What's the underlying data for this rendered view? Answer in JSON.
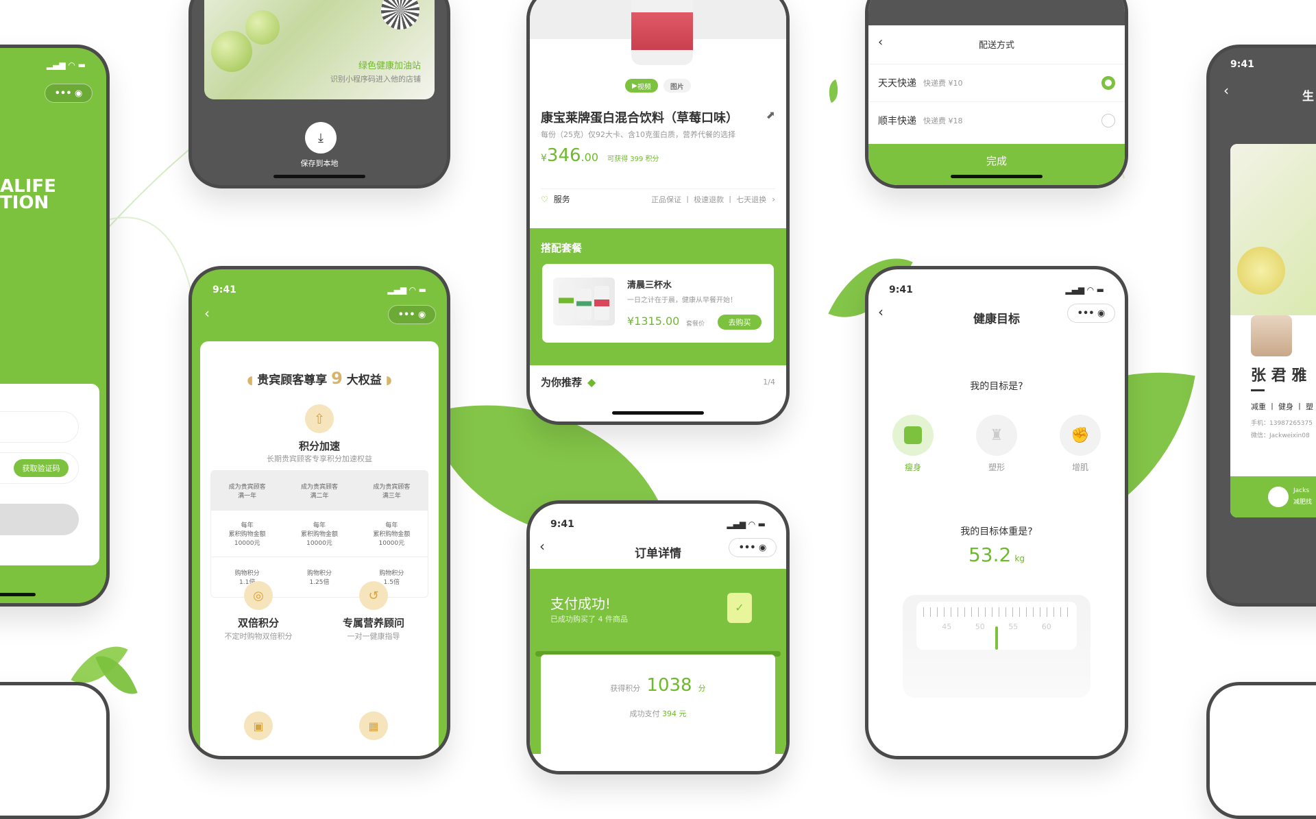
{
  "colors": {
    "accent": "#7cc23e",
    "dark_frame": "#4a4a4a"
  },
  "phone_a": {
    "brand_line1": "ALIFE",
    "brand_line2": "TION",
    "verify_btn": "获取验证码"
  },
  "phone_b": {
    "shop_name": "绿色健康加油站",
    "shop_hint": "识别小程序码进入他的店铺",
    "save_label": "保存到本地",
    "icon": "download-icon"
  },
  "phone_c": {
    "status_time": "9:41",
    "header_pre": "贵宾顾客尊享",
    "header_num": "9",
    "header_post": "大权益",
    "benefit1_title": "积分加速",
    "benefit1_desc": "长期贵宾顾客专享积分加速权益",
    "table": {
      "headers": [
        [
          "成为贵宾顾客",
          "满一年"
        ],
        [
          "成为贵宾顾客",
          "满二年"
        ],
        [
          "成为贵宾顾客",
          "满三年"
        ]
      ],
      "row1": [
        [
          "每年",
          "累积购物金额",
          "10000元"
        ],
        [
          "每年",
          "累积购物金额",
          "10000元"
        ],
        [
          "每年",
          "累积购物金额",
          "10000元"
        ]
      ],
      "row2": [
        [
          "购物积分",
          "1.1倍"
        ],
        [
          "购物积分",
          "1.25倍"
        ],
        [
          "购物积分",
          "1.5倍"
        ]
      ]
    },
    "benefit2_title": "双倍积分",
    "benefit2_desc": "不定时购物双倍积分",
    "benefit3_title": "专属营养顾问",
    "benefit3_desc": "一对一健康指导"
  },
  "phone_d": {
    "tab_video": "视频",
    "tab_image": "图片",
    "product_title": "康宝莱牌蛋白混合饮料（草莓口味）",
    "product_desc": "每份（25克）仅92大卡、含10克蛋白质，营养代餐的选择",
    "price_symbol": "¥",
    "price_int": "346",
    "price_dec": ".00",
    "points_note": "可获得 399 积分",
    "service_label": "服务",
    "service_items": "正品保证 丨 极速退款 丨 七天退换",
    "bundle_title": "搭配套餐",
    "bundle_name": "清晨三杯水",
    "bundle_desc": "一日之计在于晨，健康从早餐开始！",
    "bundle_price": "¥1315.00",
    "bundle_price_note": "套餐价",
    "bundle_btn": "去购买",
    "recommend_label": "为你推荐",
    "recommend_page": "1/4"
  },
  "phone_e": {
    "status_time": "9:41",
    "title": "订单详情",
    "success_title": "支付成功!",
    "success_desc": "已成功购买了 4 件商品",
    "points_label": "获得积分",
    "points_value": "1038",
    "points_unit": "分",
    "paid_label": "成功支付",
    "paid_value": "394",
    "paid_unit": "元"
  },
  "phone_f": {
    "title": "配送方式",
    "options": [
      {
        "name": "天天快递",
        "fee": "快递费 ¥10",
        "selected": true
      },
      {
        "name": "顺丰快递",
        "fee": "快递费 ¥18",
        "selected": false
      }
    ],
    "done_btn": "完成"
  },
  "phone_g": {
    "status_time": "9:41",
    "title": "健康目标",
    "question1": "我的目标是?",
    "goals": [
      {
        "label": "瘦身",
        "active": true
      },
      {
        "label": "塑形",
        "active": false
      },
      {
        "label": "增肌",
        "active": false
      }
    ],
    "question2": "我的目标体重是?",
    "weight": "53.2",
    "weight_unit": "kg",
    "ruler_ticks": [
      "45",
      "50",
      "55",
      "60"
    ]
  },
  "phone_h": {
    "status_time": "9:41",
    "title_partial": "生",
    "name": "张 君 雅",
    "tags": "减重 丨 健身 丨 塑",
    "phone": "手机：13987265375",
    "wechat": "微信：Jackweixin08",
    "chip_name": "Jacks",
    "chip_desc": "减肥找"
  }
}
